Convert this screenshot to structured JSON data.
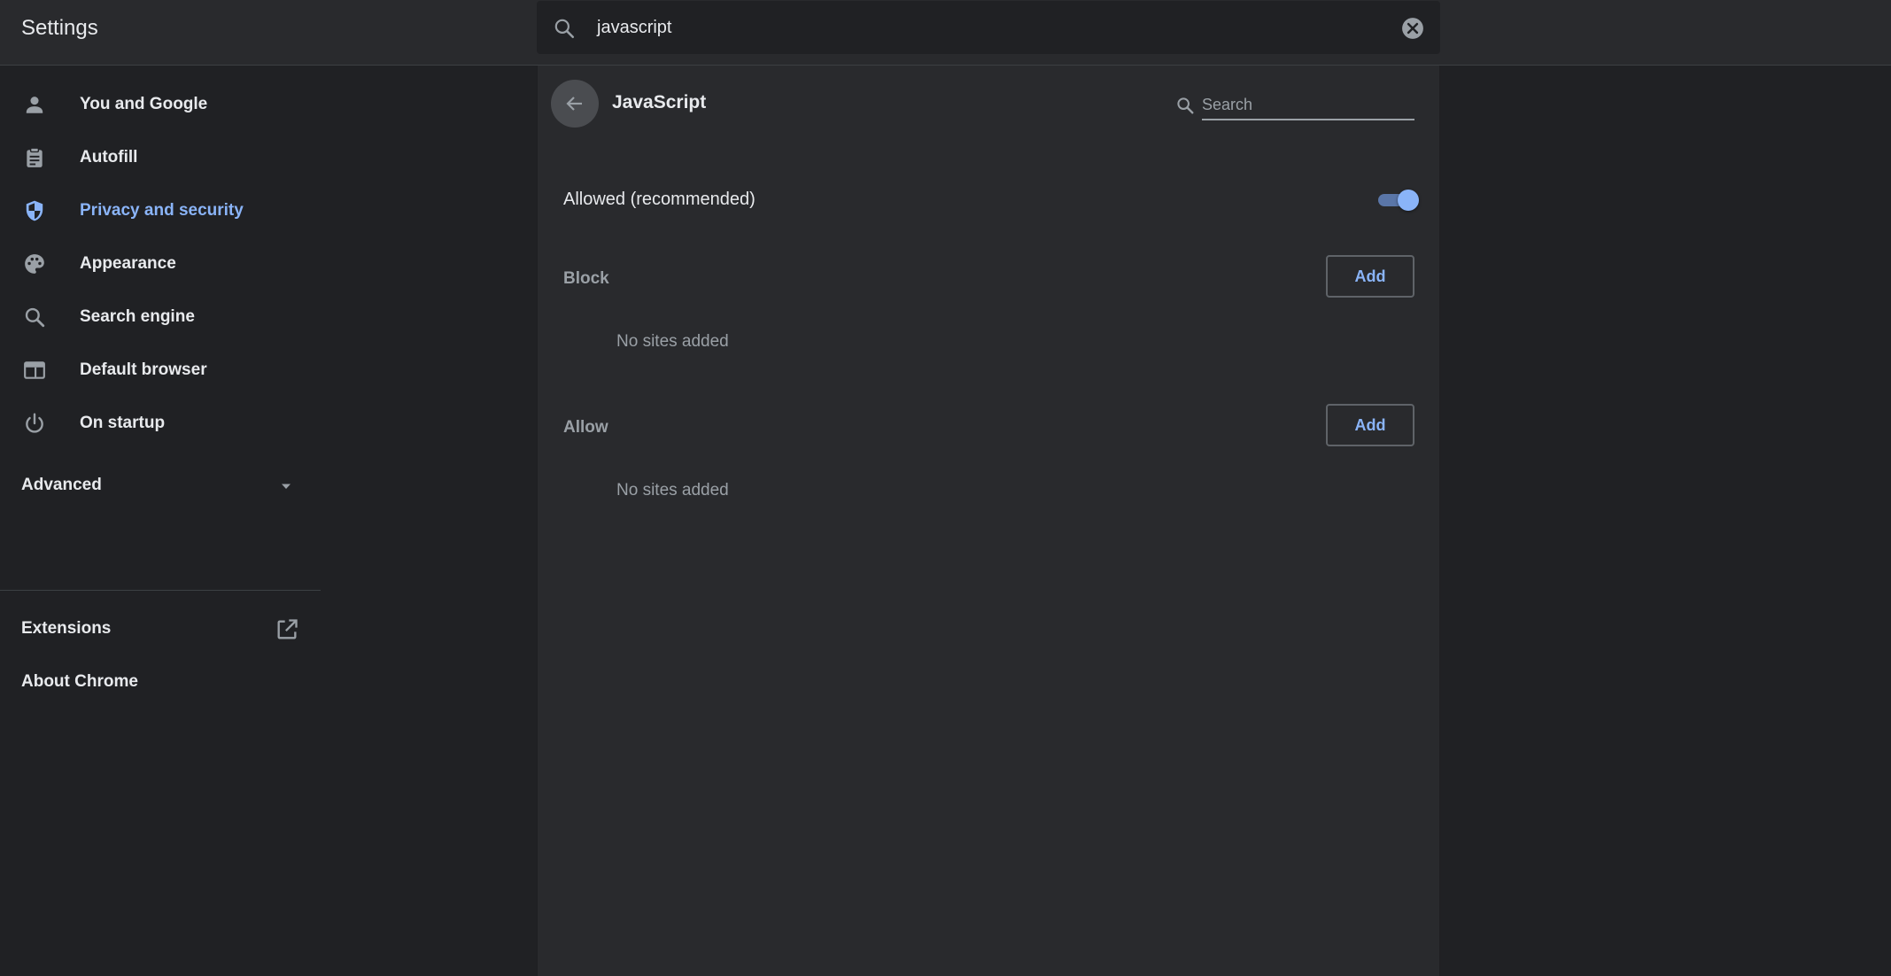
{
  "header": {
    "title": "Settings",
    "search_value": "javascript",
    "search_icon": "search-icon",
    "clear_icon": "close-circle-icon"
  },
  "sidebar": {
    "items": [
      {
        "label": "You and Google",
        "icon": "person-icon"
      },
      {
        "label": "Autofill",
        "icon": "clipboard-icon"
      },
      {
        "label": "Privacy and security",
        "icon": "shield-icon",
        "active": true
      },
      {
        "label": "Appearance",
        "icon": "palette-icon"
      },
      {
        "label": "Search engine",
        "icon": "search-icon"
      },
      {
        "label": "Default browser",
        "icon": "browser-window-icon"
      },
      {
        "label": "On startup",
        "icon": "power-icon"
      }
    ],
    "advanced_label": "Advanced",
    "extensions_label": "Extensions",
    "about_label": "About Chrome"
  },
  "main": {
    "title": "JavaScript",
    "search_placeholder": "Search",
    "allowed_label": "Allowed (recommended)",
    "allowed_toggle_on": true,
    "block": {
      "label": "Block",
      "add_label": "Add",
      "empty_text": "No sites added"
    },
    "allow": {
      "label": "Allow",
      "add_label": "Add",
      "empty_text": "No sites added"
    }
  },
  "colors": {
    "background": "#202124",
    "surface": "#292a2d",
    "accent": "#8ab4f8",
    "text_primary": "#e8eaed",
    "text_secondary": "#9aa0a6"
  }
}
